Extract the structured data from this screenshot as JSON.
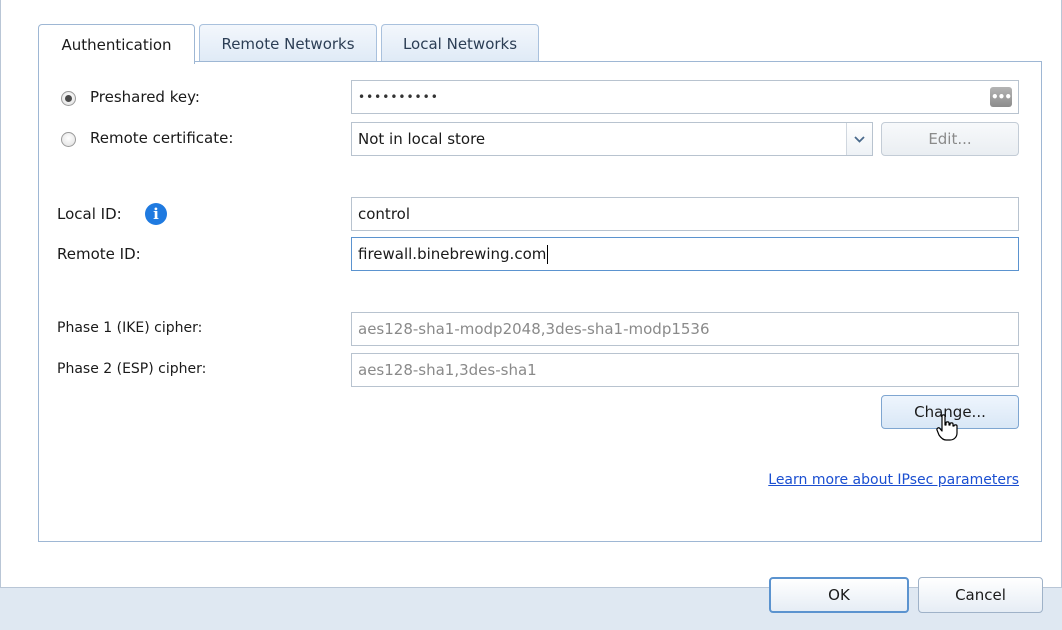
{
  "tabs": [
    {
      "label": "Authentication",
      "active": true
    },
    {
      "label": "Remote Networks",
      "active": false
    },
    {
      "label": "Local Networks",
      "active": false
    }
  ],
  "auth": {
    "preshared_label": "Preshared key:",
    "preshared_value": "••••••••••",
    "preshared_selected": true,
    "remote_cert_label": "Remote certificate:",
    "remote_cert_selected": false,
    "remote_cert_value": "Not in local store",
    "edit_label": "Edit...",
    "local_id_label": "Local ID:",
    "local_id_value": "control",
    "remote_id_label": "Remote ID:",
    "remote_id_value": "firewall.binebrewing.com",
    "phase1_label": "Phase 1 (IKE) cipher:",
    "phase1_value": "aes128-sha1-modp2048,3des-sha1-modp1536",
    "phase2_label": "Phase 2 (ESP) cipher:",
    "phase2_value": "aes128-sha1,3des-sha1",
    "change_label": "Change...",
    "learn_more_label": "Learn more about IPsec parameters"
  },
  "footer": {
    "ok_label": "OK",
    "cancel_label": "Cancel"
  },
  "icons": {
    "info": "info-icon",
    "dropdown": "chevron-down-icon",
    "more": "ellipsis-icon",
    "cursor": "hand-pointer-icon"
  },
  "colors": {
    "accent": "#5b93cf",
    "info": "#1f7ae0",
    "link": "#1b4fd1",
    "background": "#dfe8f2"
  }
}
